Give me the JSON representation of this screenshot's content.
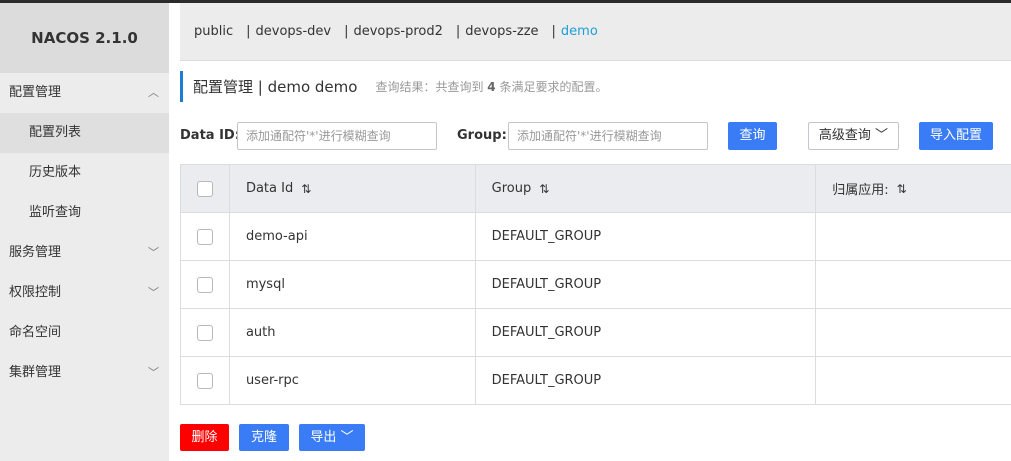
{
  "app": {
    "title": "NACOS 2.1.0"
  },
  "sidebar": {
    "items": [
      {
        "label": "配置管理",
        "chevron": "︿"
      },
      {
        "label": "配置列表"
      },
      {
        "label": "历史版本"
      },
      {
        "label": "监听查询"
      },
      {
        "label": "服务管理",
        "chevron": "﹀"
      },
      {
        "label": "权限控制",
        "chevron": "﹀"
      },
      {
        "label": "命名空间"
      },
      {
        "label": "集群管理",
        "chevron": "﹀"
      }
    ]
  },
  "namespaces": [
    "public",
    "devops-dev",
    "devops-prod2",
    "devops-zze",
    "demo"
  ],
  "namespace_separator": "|",
  "active_namespace": "demo",
  "header": {
    "title": "配置管理 | demo demo",
    "hint_prefix": "查询结果：共查询到",
    "hint_count": "4",
    "hint_suffix": "条满足要求的配置。"
  },
  "search": {
    "data_id_label": "Data ID:",
    "data_id_placeholder": "添加通配符'*'进行模糊查询",
    "group_label": "Group:",
    "group_placeholder": "添加通配符'*'进行模糊查询",
    "query_button": "查询",
    "advanced_button": "高级查询 ﹀",
    "import_button": "导入配置"
  },
  "table": {
    "columns": [
      "Data Id",
      "Group",
      "归属应用:"
    ],
    "sort_icon": "⇅",
    "rows": [
      {
        "data_id": "demo-api",
        "group": "DEFAULT_GROUP",
        "app": ""
      },
      {
        "data_id": "mysql",
        "group": "DEFAULT_GROUP",
        "app": ""
      },
      {
        "data_id": "auth",
        "group": "DEFAULT_GROUP",
        "app": ""
      },
      {
        "data_id": "user-rpc",
        "group": "DEFAULT_GROUP",
        "app": ""
      }
    ]
  },
  "actions": {
    "delete": "删除",
    "clone": "克隆",
    "export": "导出 ﹀"
  },
  "colors": {
    "primary": "#3a7cf5",
    "danger": "#ff0000",
    "active_link": "#1ea0d3",
    "title_bar": "#1a7fd4"
  }
}
